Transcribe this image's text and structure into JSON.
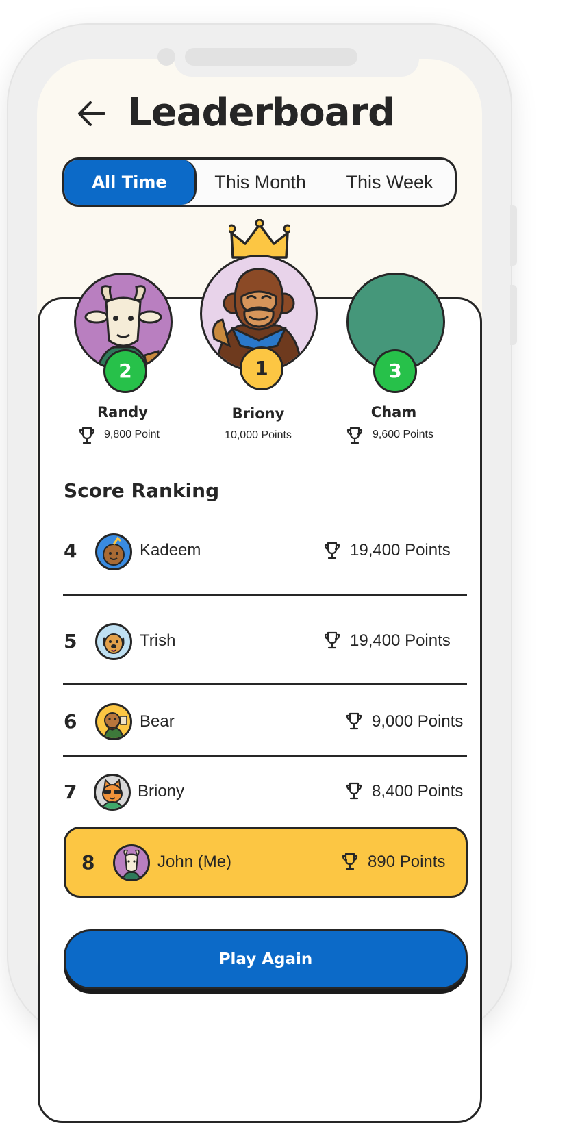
{
  "header": {
    "title": "Leaderboard"
  },
  "tabs": [
    {
      "label": "All Time",
      "active": true
    },
    {
      "label": "This Month",
      "active": false
    },
    {
      "label": "This Week",
      "active": false
    }
  ],
  "podium": [
    {
      "rank": "2",
      "name": "Randy",
      "points": "9,800 Point",
      "avatar": "goat-avatar",
      "bg": "#b97fc0",
      "badge": "#27c14a"
    },
    {
      "rank": "1",
      "name": "Briony",
      "points": "10,000 Points",
      "avatar": "gorilla-avatar",
      "bg": "#e8d3ea",
      "badge": "#fcc643"
    },
    {
      "rank": "3",
      "name": "Cham",
      "points": "9,600 Points",
      "avatar": "blank-avatar",
      "bg": "#45977a",
      "badge": "#27c14a"
    }
  ],
  "ranking": {
    "title": "Score Ranking",
    "rows": [
      {
        "rank": "4",
        "name": "Kadeem",
        "points": "19,400 Points",
        "avatar": "coconut-avatar"
      },
      {
        "rank": "5",
        "name": "Trish",
        "points": "19,400 Points",
        "avatar": "dog-avatar"
      },
      {
        "rank": "6",
        "name": "Bear",
        "points": "9,000 Points",
        "avatar": "bear-avatar"
      },
      {
        "rank": "7",
        "name": "Briony",
        "points": "8,400 Points",
        "avatar": "cat-avatar"
      }
    ],
    "me": {
      "rank": "8",
      "name": "John (Me)",
      "points": "890 Points",
      "avatar": "goat-avatar"
    }
  },
  "actions": {
    "play_again": "Play Again"
  },
  "colors": {
    "primary": "#0c6ac8",
    "highlight": "#fcc643",
    "badge_green": "#27c14a",
    "ink": "#262626"
  }
}
